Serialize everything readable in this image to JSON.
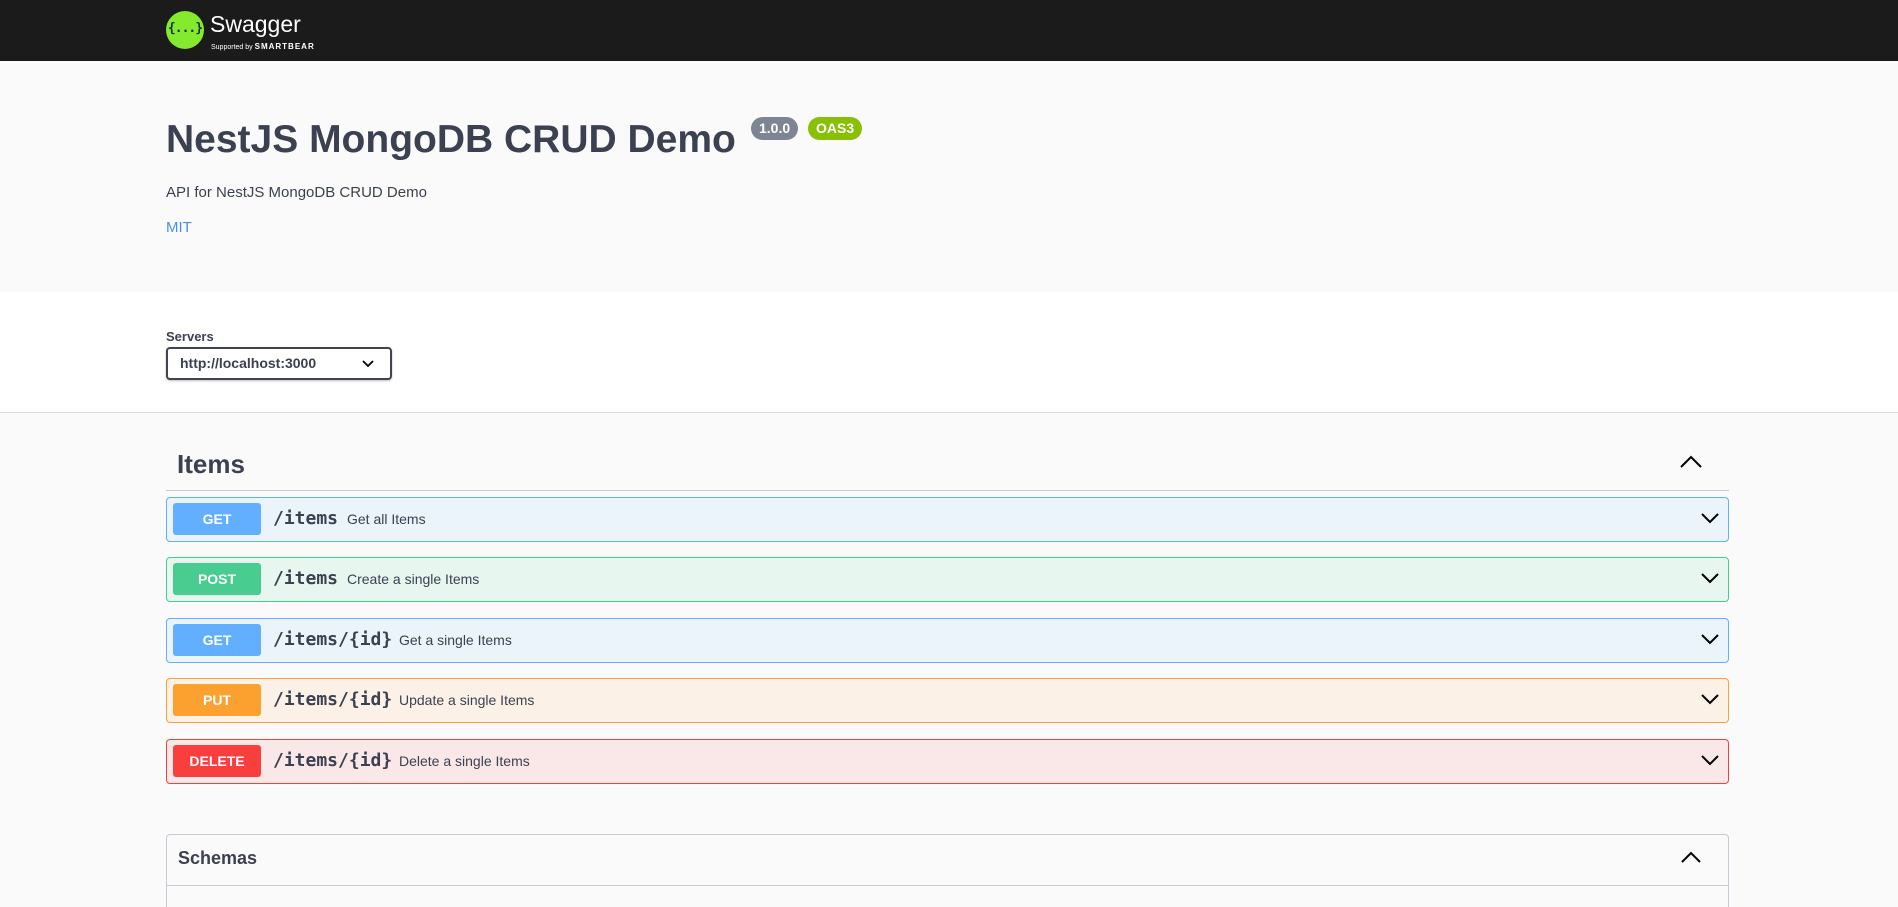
{
  "topbar": {
    "logo_mark": "{...}",
    "logo_word": "Swagger",
    "logo_sub_prefix": "Supported by",
    "logo_sub_brand": "SMARTBEAR"
  },
  "info": {
    "title": "NestJS MongoDB CRUD Demo",
    "version_badge": "1.0.0",
    "oas_badge": "OAS3",
    "description": "API for NestJS MongoDB CRUD Demo",
    "license": "MIT"
  },
  "servers": {
    "label": "Servers",
    "selected": "http://localhost:3000"
  },
  "tag": {
    "title": "Items",
    "operations": [
      {
        "method": "GET",
        "path": "/items",
        "summary": "Get all Items"
      },
      {
        "method": "POST",
        "path": "/items",
        "summary": "Create a single Items"
      },
      {
        "method": "GET",
        "path": "/items/{id}",
        "summary": "Get a single Items"
      },
      {
        "method": "PUT",
        "path": "/items/{id}",
        "summary": "Update a single Items"
      },
      {
        "method": "DELETE",
        "path": "/items/{id}",
        "summary": "Delete a single Items"
      }
    ]
  },
  "schemas": {
    "title": "Schemas"
  },
  "colors": {
    "get": "#61affe",
    "post": "#49cc90",
    "put": "#fca130",
    "delete": "#f93e3e",
    "topbar": "#1b1b1b",
    "logo": "#85ea2d"
  },
  "icons": {
    "server_select": "chevron-down-icon",
    "tag_toggle": "chevron-up-icon",
    "operation_expand": "chevron-down-icon",
    "schemas_toggle": "chevron-up-icon"
  }
}
